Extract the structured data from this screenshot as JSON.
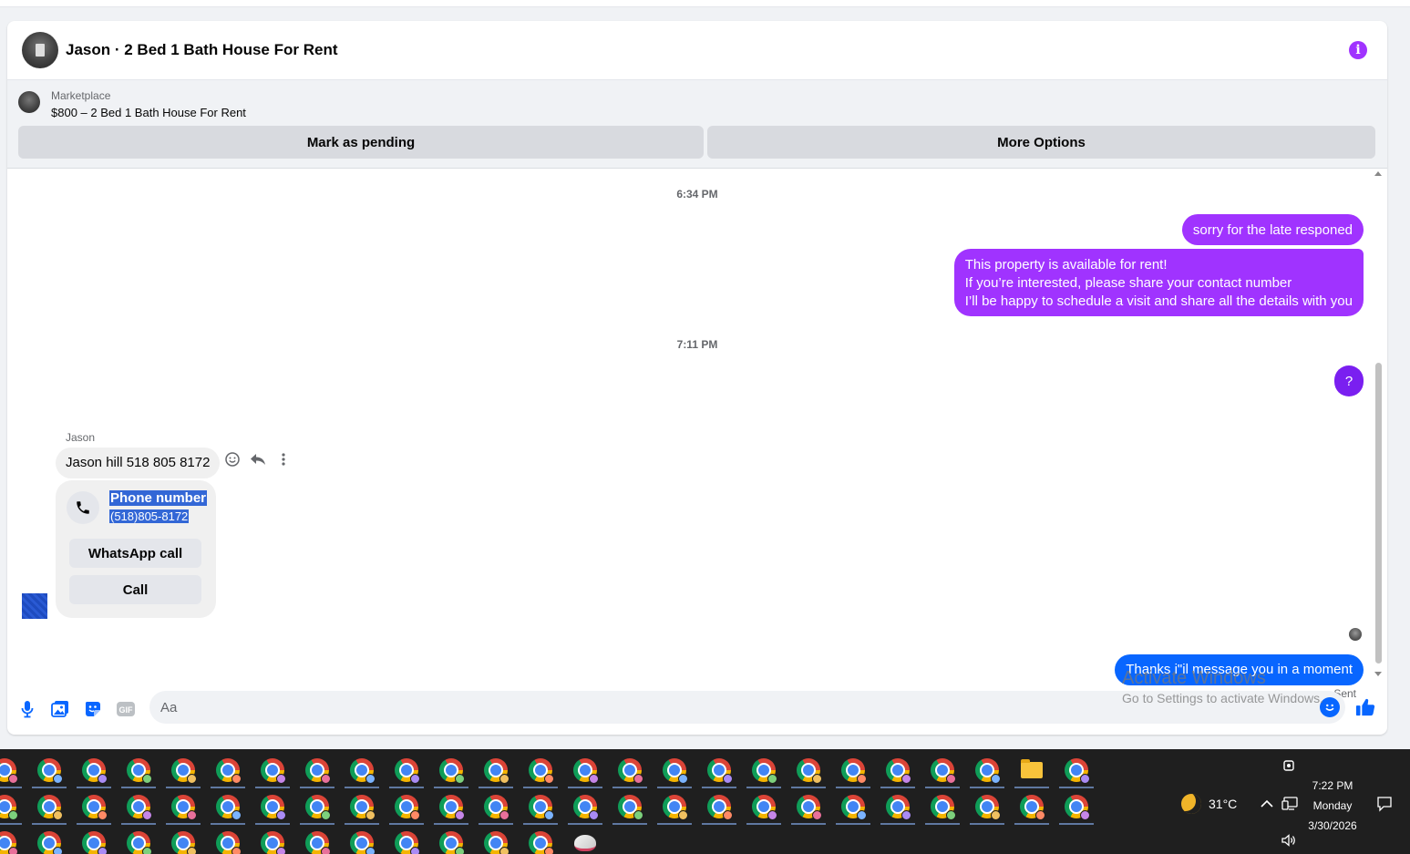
{
  "header": {
    "title": "Jason · 2 Bed 1 Bath House For Rent"
  },
  "marketplace": {
    "label": "Marketplace",
    "listing": "$800 – 2 Bed 1 Bath House For Rent",
    "mark_pending_label": "Mark as pending",
    "more_options_label": "More Options"
  },
  "messages": {
    "time_1": "6:34 PM",
    "out_1": "sorry for the late responed",
    "out_2_line1": "This property is available for rent!",
    "out_2_line2": "If you’re interested, please share your contact number",
    "out_2_line3": "I’ll be happy to schedule a visit and share all the details with you",
    "time_2": "7:11 PM",
    "out_3": "?",
    "sender_name": "Jason",
    "in_1": "Jason hill 518 805 8172",
    "contact": {
      "label": "Phone number",
      "number": "(518)805-8172",
      "whatsapp_label": "WhatsApp call",
      "call_label": "Call"
    },
    "out_4": "Thanks i\"il message you in a moment",
    "status": "Sent"
  },
  "composer": {
    "placeholder": "Aa"
  },
  "watermark": {
    "title": "Activate Windows",
    "subtitle": "Go to Settings to activate Windows."
  },
  "taskbar": {
    "weather": "31°C",
    "time": "7:22 PM",
    "day": "Monday",
    "date": "3/30/2026"
  },
  "colors": {
    "accent_purple": "#a033ff",
    "accent_blue": "#0866ff",
    "violet": "#7a1ff0"
  }
}
